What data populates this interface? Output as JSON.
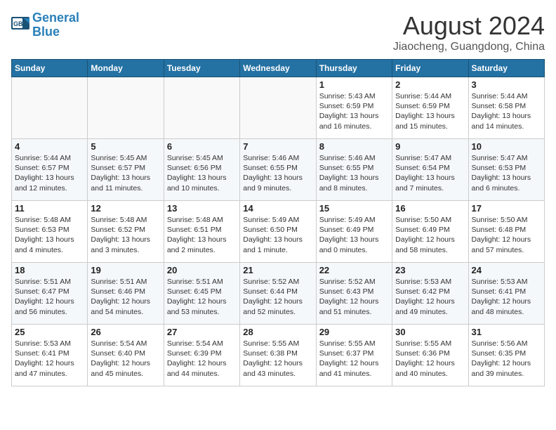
{
  "header": {
    "logo_line1": "General",
    "logo_line2": "Blue",
    "month_title": "August 2024",
    "location": "Jiaocheng, Guangdong, China"
  },
  "weekdays": [
    "Sunday",
    "Monday",
    "Tuesday",
    "Wednesday",
    "Thursday",
    "Friday",
    "Saturday"
  ],
  "weeks": [
    [
      {
        "day": "",
        "info": ""
      },
      {
        "day": "",
        "info": ""
      },
      {
        "day": "",
        "info": ""
      },
      {
        "day": "",
        "info": ""
      },
      {
        "day": "1",
        "info": "Sunrise: 5:43 AM\nSunset: 6:59 PM\nDaylight: 13 hours\nand 16 minutes."
      },
      {
        "day": "2",
        "info": "Sunrise: 5:44 AM\nSunset: 6:59 PM\nDaylight: 13 hours\nand 15 minutes."
      },
      {
        "day": "3",
        "info": "Sunrise: 5:44 AM\nSunset: 6:58 PM\nDaylight: 13 hours\nand 14 minutes."
      }
    ],
    [
      {
        "day": "4",
        "info": "Sunrise: 5:44 AM\nSunset: 6:57 PM\nDaylight: 13 hours\nand 12 minutes."
      },
      {
        "day": "5",
        "info": "Sunrise: 5:45 AM\nSunset: 6:57 PM\nDaylight: 13 hours\nand 11 minutes."
      },
      {
        "day": "6",
        "info": "Sunrise: 5:45 AM\nSunset: 6:56 PM\nDaylight: 13 hours\nand 10 minutes."
      },
      {
        "day": "7",
        "info": "Sunrise: 5:46 AM\nSunset: 6:55 PM\nDaylight: 13 hours\nand 9 minutes."
      },
      {
        "day": "8",
        "info": "Sunrise: 5:46 AM\nSunset: 6:55 PM\nDaylight: 13 hours\nand 8 minutes."
      },
      {
        "day": "9",
        "info": "Sunrise: 5:47 AM\nSunset: 6:54 PM\nDaylight: 13 hours\nand 7 minutes."
      },
      {
        "day": "10",
        "info": "Sunrise: 5:47 AM\nSunset: 6:53 PM\nDaylight: 13 hours\nand 6 minutes."
      }
    ],
    [
      {
        "day": "11",
        "info": "Sunrise: 5:48 AM\nSunset: 6:53 PM\nDaylight: 13 hours\nand 4 minutes."
      },
      {
        "day": "12",
        "info": "Sunrise: 5:48 AM\nSunset: 6:52 PM\nDaylight: 13 hours\nand 3 minutes."
      },
      {
        "day": "13",
        "info": "Sunrise: 5:48 AM\nSunset: 6:51 PM\nDaylight: 13 hours\nand 2 minutes."
      },
      {
        "day": "14",
        "info": "Sunrise: 5:49 AM\nSunset: 6:50 PM\nDaylight: 13 hours\nand 1 minute."
      },
      {
        "day": "15",
        "info": "Sunrise: 5:49 AM\nSunset: 6:49 PM\nDaylight: 13 hours\nand 0 minutes."
      },
      {
        "day": "16",
        "info": "Sunrise: 5:50 AM\nSunset: 6:49 PM\nDaylight: 12 hours\nand 58 minutes."
      },
      {
        "day": "17",
        "info": "Sunrise: 5:50 AM\nSunset: 6:48 PM\nDaylight: 12 hours\nand 57 minutes."
      }
    ],
    [
      {
        "day": "18",
        "info": "Sunrise: 5:51 AM\nSunset: 6:47 PM\nDaylight: 12 hours\nand 56 minutes."
      },
      {
        "day": "19",
        "info": "Sunrise: 5:51 AM\nSunset: 6:46 PM\nDaylight: 12 hours\nand 54 minutes."
      },
      {
        "day": "20",
        "info": "Sunrise: 5:51 AM\nSunset: 6:45 PM\nDaylight: 12 hours\nand 53 minutes."
      },
      {
        "day": "21",
        "info": "Sunrise: 5:52 AM\nSunset: 6:44 PM\nDaylight: 12 hours\nand 52 minutes."
      },
      {
        "day": "22",
        "info": "Sunrise: 5:52 AM\nSunset: 6:43 PM\nDaylight: 12 hours\nand 51 minutes."
      },
      {
        "day": "23",
        "info": "Sunrise: 5:53 AM\nSunset: 6:42 PM\nDaylight: 12 hours\nand 49 minutes."
      },
      {
        "day": "24",
        "info": "Sunrise: 5:53 AM\nSunset: 6:41 PM\nDaylight: 12 hours\nand 48 minutes."
      }
    ],
    [
      {
        "day": "25",
        "info": "Sunrise: 5:53 AM\nSunset: 6:41 PM\nDaylight: 12 hours\nand 47 minutes."
      },
      {
        "day": "26",
        "info": "Sunrise: 5:54 AM\nSunset: 6:40 PM\nDaylight: 12 hours\nand 45 minutes."
      },
      {
        "day": "27",
        "info": "Sunrise: 5:54 AM\nSunset: 6:39 PM\nDaylight: 12 hours\nand 44 minutes."
      },
      {
        "day": "28",
        "info": "Sunrise: 5:55 AM\nSunset: 6:38 PM\nDaylight: 12 hours\nand 43 minutes."
      },
      {
        "day": "29",
        "info": "Sunrise: 5:55 AM\nSunset: 6:37 PM\nDaylight: 12 hours\nand 41 minutes."
      },
      {
        "day": "30",
        "info": "Sunrise: 5:55 AM\nSunset: 6:36 PM\nDaylight: 12 hours\nand 40 minutes."
      },
      {
        "day": "31",
        "info": "Sunrise: 5:56 AM\nSunset: 6:35 PM\nDaylight: 12 hours\nand 39 minutes."
      }
    ]
  ]
}
